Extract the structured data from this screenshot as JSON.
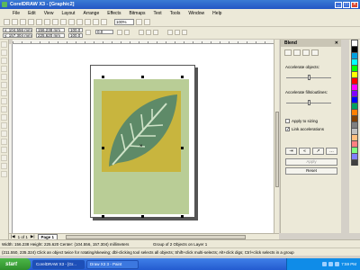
{
  "window": {
    "title": "CorelDRAW X3 - [Graphic2]",
    "buttons": [
      "_",
      "□",
      "✕"
    ]
  },
  "menu": [
    "File",
    "Edit",
    "View",
    "Layout",
    "Arrange",
    "Effects",
    "Bitmaps",
    "Text",
    "Tools",
    "Window",
    "Help"
  ],
  "toolbar": {
    "zoom": "100%"
  },
  "property_bar": {
    "x": "x: 104.556 mm",
    "y": "y: 157.304 mm",
    "width": "156.238 mm",
    "height": "225.620 mm",
    "scale_x": "100.0",
    "scale_y": "100.0",
    "angle": "0.0"
  },
  "docker": {
    "title": "Blend",
    "close": "✕",
    "accelerate_objects": "Accelerate objects:",
    "accelerate_fills": "Accelerate fills/outlines:",
    "accelerate_objects_value": 0.5,
    "accelerate_fills_value": 0.5,
    "apply_to_sizing": "Apply to sizing",
    "link_accelerations": "Link accelerations",
    "link_checked_mark": "✓",
    "nav": [
      "⇥",
      "«",
      "↗",
      "…"
    ],
    "apply": "Apply",
    "reset": "Reset"
  },
  "pages": {
    "counter": "1 of 1",
    "page_tab": "Page 1"
  },
  "status": {
    "line1_left": "Width: 156.238 Height: 225.620 Center: (104.556, 157.304) millimeters",
    "line1_mid": "Group of 2 Objects on Layer 1",
    "line2": "(211.550, 235.324)  Click an object twice for rotating/skewing; dbl-clicking tool selects all objects; Shift+click multi-selects; Alt+click digs; Ctrl+click selects in a group"
  },
  "taskbar": {
    "start": "start",
    "tasks": [
      "CorelDRAW X3 - [Gr...",
      "Draw X3 3 - Paint"
    ],
    "clock": "7:59 PM"
  },
  "colors": {
    "leaf": "#5e8a68",
    "leaf_box": "#c8b53e",
    "background_rect": "#b9cd96",
    "accent_blue": "#2356c4"
  },
  "palette": [
    "#ffffff",
    "#000000",
    "#00a0e0",
    "#00ffff",
    "#00ff00",
    "#ffff00",
    "#ff0000",
    "#ff00ff",
    "#8000ff",
    "#0000ff",
    "#00a060",
    "#ff8000",
    "#804000",
    "#808080",
    "#c0c0c0",
    "#ffc080",
    "#ff8080",
    "#80ff80",
    "#8080ff",
    "#404040"
  ]
}
